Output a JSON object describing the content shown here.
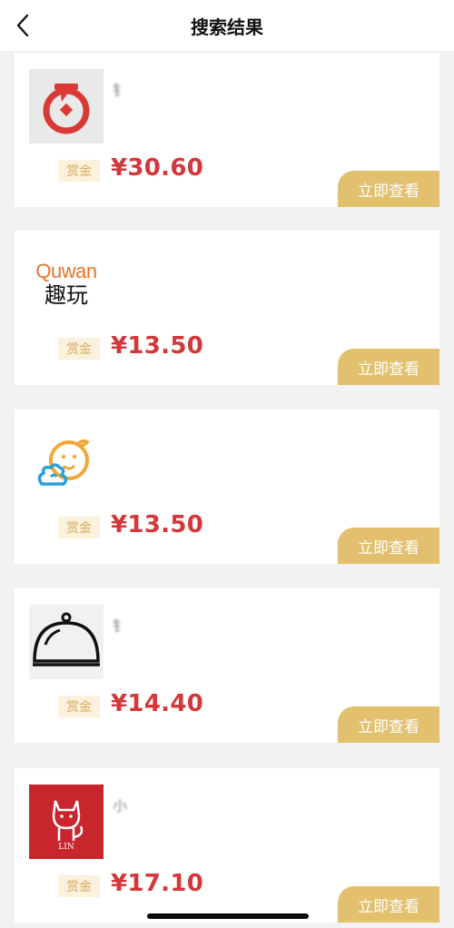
{
  "header": {
    "title": "搜索结果",
    "back_icon": "chevron-left-icon"
  },
  "items": [
    {
      "name": "钅",
      "reward_label": "赏金",
      "price": "¥30.60",
      "button": "立即查看",
      "logo": "red-circle-logo"
    },
    {
      "name": "",
      "reward_label": "赏金",
      "price": "¥13.50",
      "button": "立即查看",
      "logo": "quwan-logo",
      "logo_text_top": "Quwan",
      "logo_text_bottom": "趣玩"
    },
    {
      "name": "",
      "reward_label": "赏金",
      "price": "¥13.50",
      "button": "立即查看",
      "logo": "gourd-cloud-logo"
    },
    {
      "name": "钅",
      "reward_label": "赏金",
      "price": "¥14.40",
      "button": "立即查看",
      "logo": "food-cloche-logo"
    },
    {
      "name": "小",
      "reward_label": "赏金",
      "price": "¥17.10",
      "button": "立即查看",
      "logo": "cat-lin-logo",
      "logo_text": "LIN"
    }
  ],
  "colors": {
    "price": "#d4373a",
    "button_bg": "#e2c06d",
    "tag_bg": "#fbf1dc",
    "tag_text": "#d6ad5e",
    "background": "#f2f2f2"
  }
}
